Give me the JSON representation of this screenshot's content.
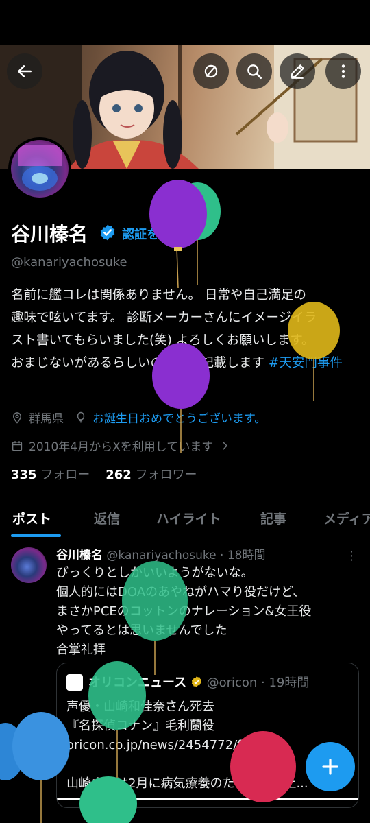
{
  "profile": {
    "name": "谷川榛名",
    "verify_link": "認証を受ける",
    "handle": "@kanariyachosuke",
    "bio_lines": [
      "名前に艦コレは関係ありません。 日常や自己満足の",
      "趣味で呟いてます。 診断メーカーさんにイメージイラ",
      "スト書いてもらいました(笑) よろしくお願いします。",
      "おまじないがあるらしいので暫く記載します "
    ],
    "hashtag": "#天安門事件",
    "location": "群馬県",
    "birthday_text": "お誕生日おめでとうございます。",
    "joined": "2010年4月からXを利用しています",
    "following_count": "335",
    "following_label": "フォロー",
    "followers_count": "262",
    "followers_label": "フォロワー"
  },
  "tabs": [
    {
      "label": "ポスト",
      "active": true
    },
    {
      "label": "返信"
    },
    {
      "label": "ハイライト"
    },
    {
      "label": "記事"
    },
    {
      "label": "メディア"
    }
  ],
  "post": {
    "name": "谷川榛名",
    "handle": "@kanariyachosuke",
    "time": "18時間",
    "body": "びっくりとしかいいようがないな。\n個人的にはDOAのあやねがハマり役だけど、\nまさかPCEのコットンのナレーション&女王役\nやってるとは思いませんでした\n合掌礼拝",
    "quote": {
      "name": "オリコンニュース",
      "handle": "@oricon",
      "time": "19時間",
      "body": "声優・山崎和佳奈さん死去\n『名探偵コナン』毛利蘭役\noricon.co.jp/news/2454772/f...\n\n山崎さんは2月に病気療養のため活動休止..."
    }
  },
  "icons": {
    "back": "arrow-left-icon",
    "hide": "eye-slash-icon",
    "search": "search-icon",
    "edit": "pencil-icon",
    "more": "more-vertical-icon",
    "verified": "verified-badge-icon",
    "location": "location-pin-icon",
    "birthday": "balloon-icon",
    "calendar": "calendar-icon",
    "compose": "plus-icon"
  },
  "colors": {
    "accent": "#1d9bf0",
    "background": "#000000",
    "text": "#e7e9ea",
    "muted": "#71767b"
  }
}
